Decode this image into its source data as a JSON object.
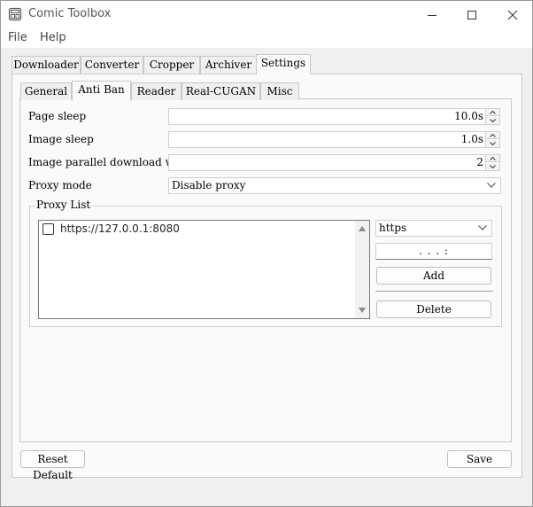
{
  "window": {
    "title": "Comic Toolbox",
    "controls": [
      "minimize-icon",
      "maximize-icon",
      "close-icon"
    ]
  },
  "menu": {
    "items": [
      "File",
      "Help"
    ]
  },
  "main_tabs": {
    "items": [
      "Downloader",
      "Converter",
      "Cropper",
      "Archiver",
      "Settings"
    ],
    "active": "Settings"
  },
  "settings_tabs": {
    "items": [
      "General",
      "Anti Ban",
      "Reader",
      "Real-CUGAN",
      "Misc"
    ],
    "active": "Anti Ban"
  },
  "anti_ban": {
    "page_sleep": {
      "label": "Page sleep",
      "value": "10.0s"
    },
    "image_sleep": {
      "label": "Image sleep",
      "value": "1.0s"
    },
    "image_workers": {
      "label": "Image parallel download worker",
      "value": "2"
    },
    "proxy_mode": {
      "label": "Proxy mode",
      "value": "Disable proxy"
    }
  },
  "proxy_list": {
    "title": "Proxy List",
    "items": [
      {
        "text": "https://127.0.0.1:8080",
        "checked": false
      }
    ],
    "protocol": "https",
    "address": " .  .  . :",
    "add_label": "Add",
    "delete_label": "Delete"
  },
  "footer": {
    "reset_label": "Reset Default",
    "save_label": "Save"
  }
}
